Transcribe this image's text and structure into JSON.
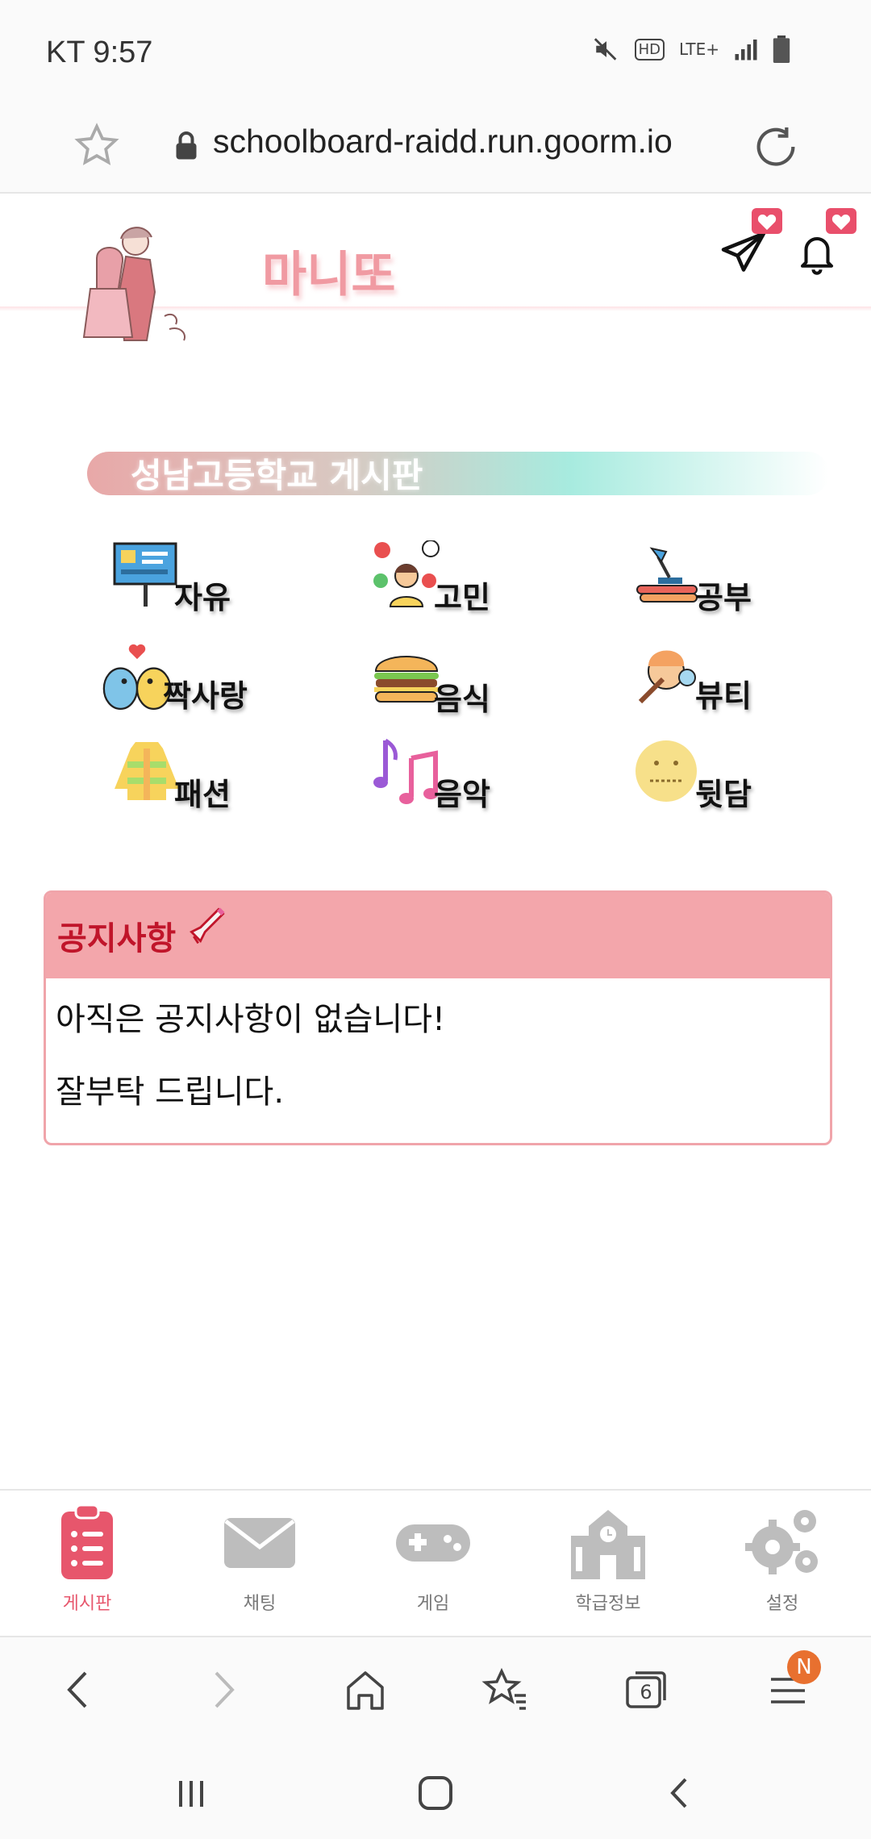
{
  "status_bar": {
    "time": "KT 9:57",
    "icons": [
      "mute-icon",
      "hd-icon",
      "lte-icon",
      "signal-icon",
      "battery-icon"
    ],
    "hd_label": "HD",
    "lte_label": "LTE+"
  },
  "browser": {
    "url": "schoolboard-raidd.run.goorm.io",
    "tabs_count": "6",
    "menu_badge": "N"
  },
  "header": {
    "title": "마니또"
  },
  "board": {
    "title": "성남고등학교 게시판",
    "categories": [
      {
        "label": "자유",
        "icon": "presentation-board-icon"
      },
      {
        "label": "고민",
        "icon": "worried-person-icon"
      },
      {
        "label": "공부",
        "icon": "desk-lamp-books-icon"
      },
      {
        "label": "짝사랑",
        "icon": "love-birds-icon"
      },
      {
        "label": "음식",
        "icon": "burger-icon"
      },
      {
        "label": "뷰티",
        "icon": "makeup-icon"
      },
      {
        "label": "패션",
        "icon": "jacket-icon"
      },
      {
        "label": "음악",
        "icon": "music-notes-icon"
      },
      {
        "label": "뒷담",
        "icon": "zipper-mouth-face-icon"
      }
    ]
  },
  "notice": {
    "title": "공지사항",
    "line1": "아직은 공지사항이 없습니다!",
    "line2": "잘부탁 드립니다."
  },
  "app_nav": {
    "items": [
      {
        "label": "게시판",
        "active": true
      },
      {
        "label": "채팅",
        "active": false
      },
      {
        "label": "게임",
        "active": false
      },
      {
        "label": "학급정보",
        "active": false
      },
      {
        "label": "설정",
        "active": false
      }
    ]
  },
  "colors": {
    "accent": "#e7566c",
    "title_pink": "#f09aa2",
    "notice_header": "#f3a6ab",
    "notice_title": "#c0152a",
    "inactive_icon": "#bdbdbd"
  }
}
